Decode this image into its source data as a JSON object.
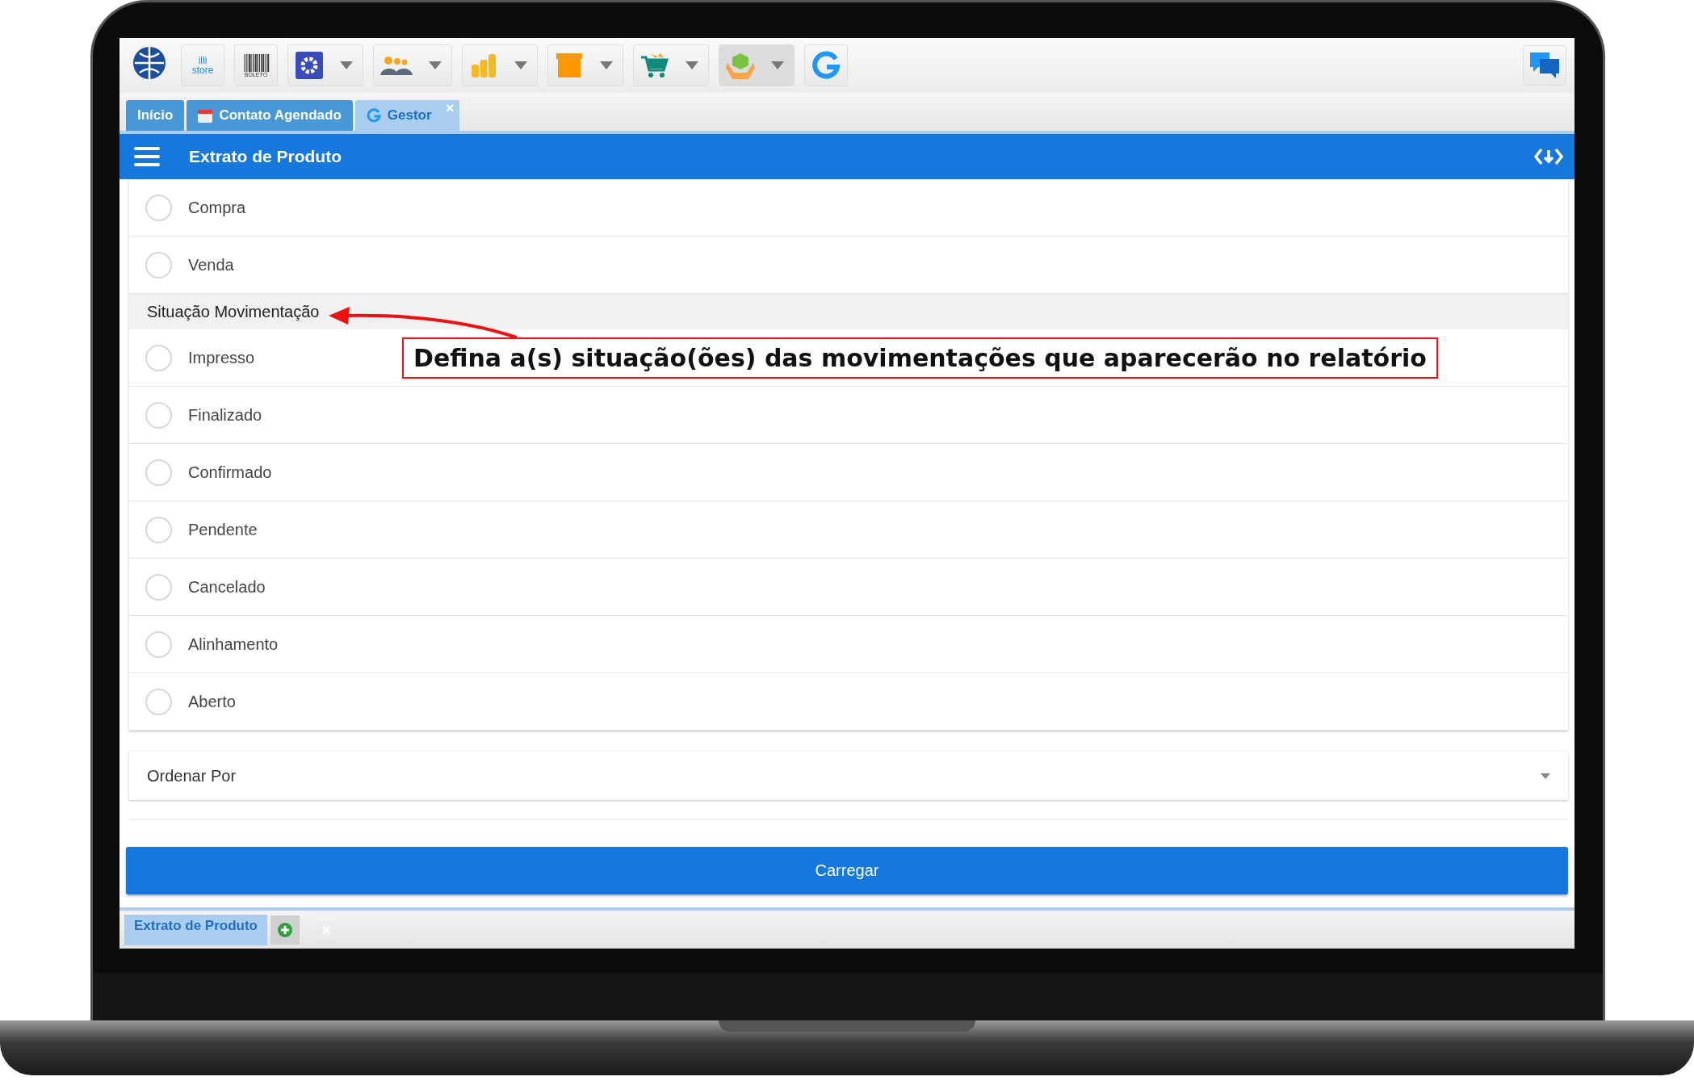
{
  "toolbar": {
    "buttons": [
      {
        "kind": "logo",
        "dropdown": false
      },
      {
        "kind": "store",
        "label": "illi store",
        "dropdown": false
      },
      {
        "kind": "barcode",
        "label": "BOLETO",
        "dropdown": false
      },
      {
        "kind": "gear",
        "dropdown": true
      },
      {
        "kind": "people",
        "dropdown": true
      },
      {
        "kind": "coins",
        "dropdown": true
      },
      {
        "kind": "box",
        "dropdown": true
      },
      {
        "kind": "cart",
        "dropdown": true
      },
      {
        "kind": "hands",
        "dropdown": true
      },
      {
        "kind": "refresh",
        "dropdown": false
      }
    ],
    "right_buttons": [
      {
        "kind": "chat"
      }
    ]
  },
  "tabs": [
    {
      "label": "Início",
      "kind": "plain",
      "selected": false
    },
    {
      "label": "Contato Agendado",
      "kind": "calendar",
      "selected": false
    },
    {
      "label": "Gestor",
      "kind": "refresh",
      "close": "×",
      "selected": true
    }
  ],
  "header": {
    "title": "Extrato de Produto"
  },
  "groups": [
    {
      "options": [
        {
          "label": "Compra",
          "checked": false
        },
        {
          "label": "Venda",
          "checked": false
        }
      ]
    },
    {
      "title": "Situação Movimentação",
      "options": [
        {
          "label": "Impresso",
          "checked": false
        },
        {
          "label": "Finalizado",
          "checked": false
        },
        {
          "label": "Confirmado",
          "checked": false
        },
        {
          "label": "Pendente",
          "checked": false
        },
        {
          "label": "Cancelado",
          "checked": false
        },
        {
          "label": "Alinhamento",
          "checked": false
        },
        {
          "label": "Aberto",
          "checked": false
        }
      ]
    }
  ],
  "order_field": {
    "placeholder": "Ordenar Por"
  },
  "load_button": "Carregar",
  "bottom_tabs": [
    {
      "label": "Extrato de Produto",
      "selected": true
    }
  ],
  "annotation": "Defina a(s) situação(ões) das movimentações que aparecerão no relatório"
}
